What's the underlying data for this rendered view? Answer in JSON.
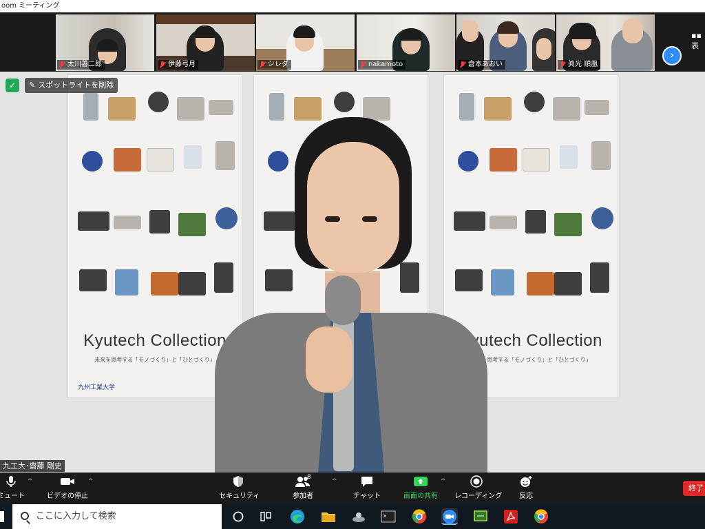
{
  "window": {
    "title": "oom ミーティング"
  },
  "gallery": {
    "participants": [
      {
        "name": "太川善二郎",
        "muted": true
      },
      {
        "name": "伊藤弓月",
        "muted": true
      },
      {
        "name": "シレダ",
        "muted": true
      },
      {
        "name": "nakamoto",
        "muted": true
      },
      {
        "name": "倉本あおい",
        "muted": true
      },
      {
        "name": "眞光 順凰",
        "muted": true
      }
    ],
    "next_label": "›",
    "view_label": "表"
  },
  "main": {
    "spotlight_label": "スポットライトを削除",
    "speaker_name": "九工大･齋藤 剛史",
    "poster_title": "Kyutech Collection",
    "poster_subtitle": "未来を思考する「モノづくり」と「ひとづくり」",
    "poster_university": "九州工業大学"
  },
  "toolbar": {
    "mute_label": "ミュート",
    "video_label": "ビデオの停止",
    "security_label": "セキュリティ",
    "participants_label": "参加者",
    "participants_count": "8",
    "chat_label": "チャット",
    "share_label": "画面の共有",
    "record_label": "レコーディング",
    "reactions_label": "反応",
    "end_label": "終了"
  },
  "taskbar": {
    "search_placeholder": "ここに入力して検索"
  },
  "colors": {
    "share_green": "#36d35c",
    "end_red": "#e02828",
    "accent_blue": "#2d8cff",
    "security_green": "#23a85b"
  }
}
